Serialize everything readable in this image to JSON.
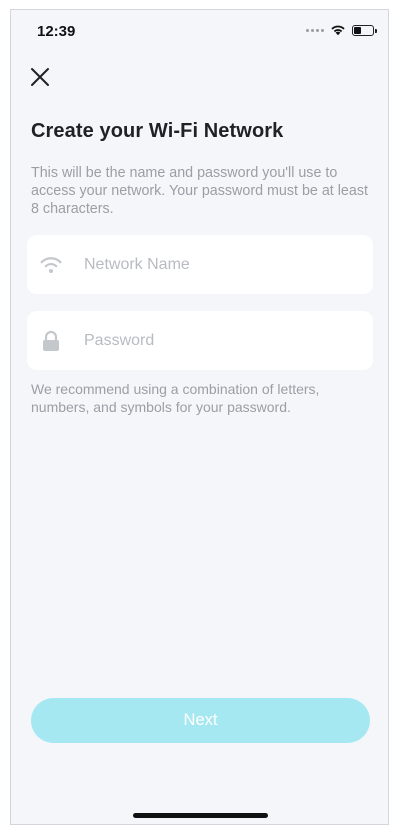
{
  "status_bar": {
    "time": "12:39",
    "battery_level": 0.4
  },
  "header": {
    "close_icon": "close-icon"
  },
  "main": {
    "title": "Create your Wi-Fi Network",
    "description": "This will be the name and password you'll use to access your network. Your password must be at least 8 characters.",
    "network_name": {
      "icon": "wifi-icon",
      "value": "",
      "placeholder": "Network Name"
    },
    "password": {
      "icon": "lock-icon",
      "value": "",
      "placeholder": "Password"
    },
    "hint": "We recommend using a combination of letters, numbers, and symbols for your password."
  },
  "footer": {
    "next_label": "Next"
  },
  "colors": {
    "accent_disabled": "#a6e8f1",
    "background": "#f5f6fa",
    "muted_text": "#9b9ea5"
  }
}
